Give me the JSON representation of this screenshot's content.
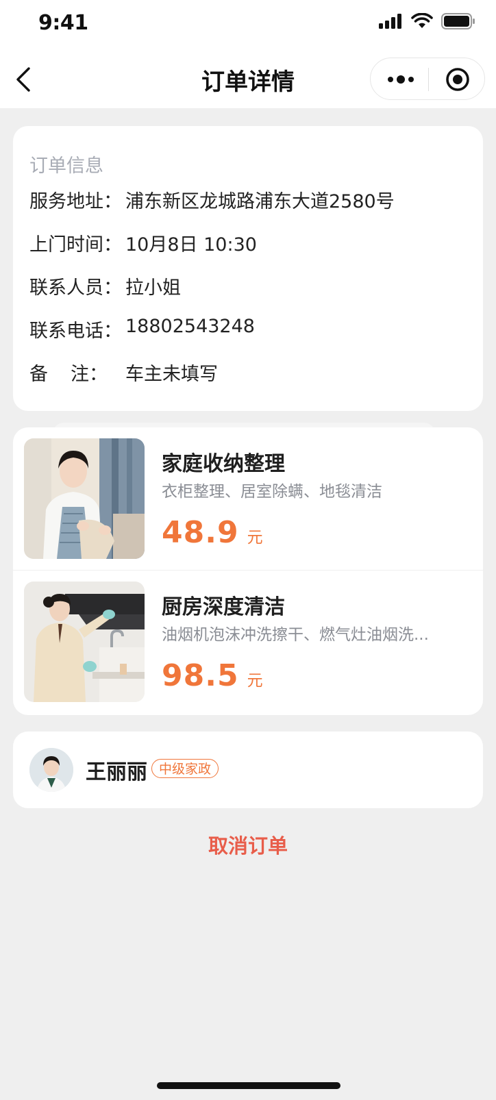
{
  "status_bar": {
    "time": "9:41"
  },
  "header": {
    "title": "订单详情"
  },
  "order_info": {
    "section_title": "订单信息",
    "rows": [
      {
        "label": "服务地址：",
        "value": "浦东新区龙城路浦东大道2580号"
      },
      {
        "label": "上门时间：",
        "value": "10月8日 10:30"
      },
      {
        "label": "联系人员：",
        "value": "拉小姐"
      },
      {
        "label": "联系电话：",
        "value": "18802543248"
      },
      {
        "label_a": "备",
        "label_b": "注：",
        "value": "车主未填写"
      }
    ]
  },
  "items": [
    {
      "name": "家庭收纳整理",
      "desc": "衣柜整理、居室除螨、地毯清洁",
      "price": "48.9",
      "unit": "元"
    },
    {
      "name": "厨房深度清洁",
      "desc": "油烟机泡沫冲洗擦干、燃气灶油烟洗...",
      "price": "98.5",
      "unit": "元"
    }
  ],
  "worker": {
    "name": "王丽丽",
    "level": "中级家政"
  },
  "actions": {
    "cancel_label": "取消订单"
  },
  "colors": {
    "accent": "#f0763a",
    "cancel": "#e85d4a",
    "background": "#efefef"
  }
}
